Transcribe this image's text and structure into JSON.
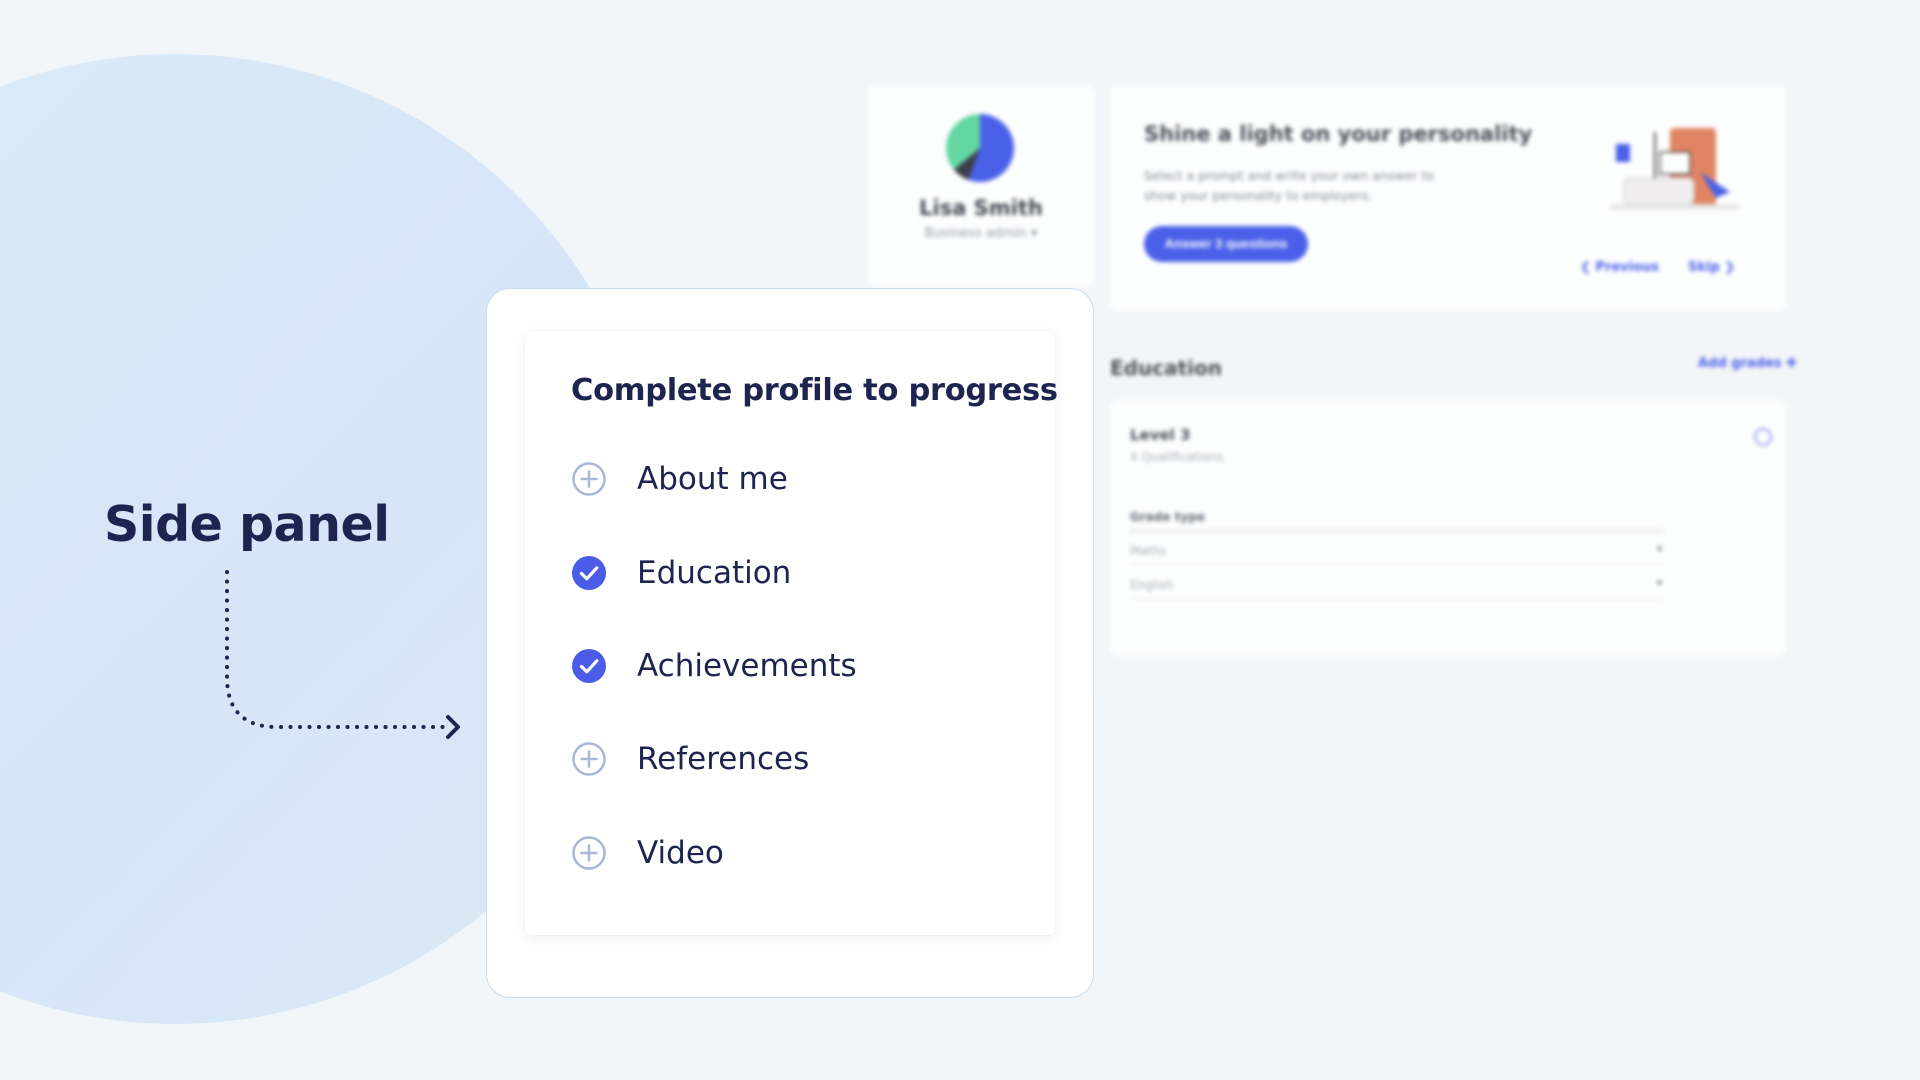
{
  "headline": "Side panel",
  "background_app": {
    "profile": {
      "name": "Lisa Smith",
      "role": "Business admin ▾"
    },
    "prompt_card": {
      "title": "Shine a light on your personality",
      "description": "Select a prompt and write your own answer to show your personality to employers.",
      "button_label": "Answer 3 questions",
      "previous_label": "❮ Previous",
      "skip_label": "Skip ❯"
    },
    "education": {
      "heading": "Education",
      "add_label": "Add grades ✚",
      "level": "Level 3",
      "qualifications": "4 Qualifications",
      "grade_type_header": "Grade type",
      "rows": [
        {
          "subject": "Maths"
        },
        {
          "subject": "English"
        }
      ]
    }
  },
  "side_panel": {
    "title": "Complete profile to progress",
    "steps": [
      {
        "label": "About me",
        "status": "incomplete",
        "icon": "plus-circle-icon"
      },
      {
        "label": "Education",
        "status": "complete",
        "icon": "check-circle-icon"
      },
      {
        "label": "Achievements",
        "status": "complete",
        "icon": "check-circle-icon"
      },
      {
        "label": "References",
        "status": "incomplete",
        "icon": "plus-circle-icon"
      },
      {
        "label": "Video",
        "status": "incomplete",
        "icon": "plus-circle-icon"
      }
    ]
  },
  "colors": {
    "page_background": "#f1f6fb",
    "ink": "#1d2450",
    "accent": "#4b5ce8",
    "incomplete_icon": "#aab7d6",
    "panel_border": "#c9dbf2",
    "avatar_green": "#57d49a"
  }
}
